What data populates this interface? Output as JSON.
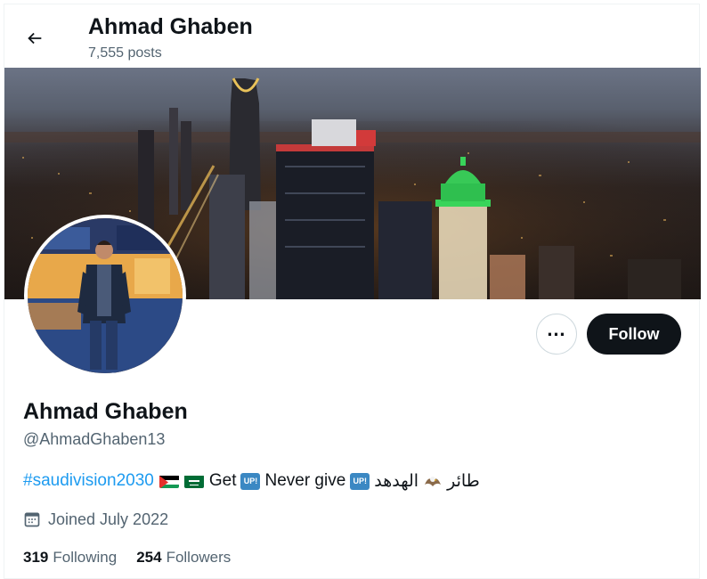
{
  "header": {
    "name": "Ahmad Ghaben",
    "post_count": "7,555 posts",
    "back_icon": "arrow-left-icon"
  },
  "profile": {
    "name": "Ahmad Ghaben",
    "handle": "@AhmadGhaben13",
    "bio": {
      "hashtag": "#saudivision2030",
      "get": "Get",
      "up_badge": "UP!",
      "never_give": "Never give",
      "arabic_1": "الهدهد",
      "arabic_2": "طائر",
      "emojis": [
        "palestine-flag-icon",
        "saudi-flag-icon",
        "up-button-icon",
        "eagle-icon"
      ]
    },
    "joined": "Joined July 2022",
    "following_count": "319",
    "following_label": "Following",
    "followers_count": "254",
    "followers_label": "Followers"
  },
  "actions": {
    "more_label": "…",
    "follow_label": "Follow"
  },
  "colors": {
    "link": "#1d9bf0",
    "text_primary": "#0f1419",
    "text_secondary": "#536471",
    "follow_bg": "#0f1419",
    "border": "#cfd9de"
  }
}
